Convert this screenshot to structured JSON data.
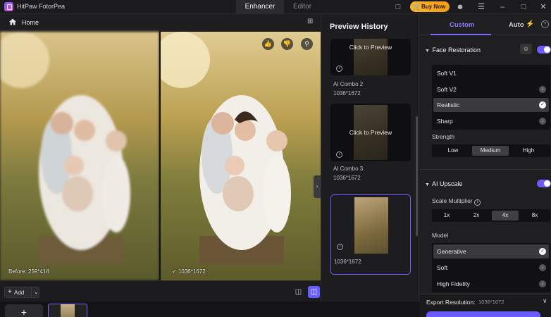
{
  "app": {
    "name": "HitPaw FotorPea"
  },
  "mode_tabs": [
    {
      "label": "Enhancer",
      "active": true
    },
    {
      "label": "Editor",
      "active": false
    }
  ],
  "title_icons": [
    "chat-icon",
    "gift-icon",
    "user-icon",
    "menu-icon",
    "minimize-icon",
    "maximize-icon",
    "close-icon"
  ],
  "buy_button": {
    "label": "Buy Now"
  },
  "home": {
    "label": "Home"
  },
  "canvas": {
    "before_label": "Before: 259*418",
    "after_label": "1036*1672"
  },
  "bottom": {
    "add_label": "Add",
    "zoom_level": 0
  },
  "history": {
    "title": "Preview History",
    "items": [
      {
        "cta": "Click to Preview",
        "name": "AI Combo 2",
        "size": "1036*1672"
      },
      {
        "cta": "Click to Preview",
        "name": "AI Combo 3",
        "size": "1036*1672"
      },
      {
        "cta": "",
        "name": "",
        "size": "1036*1672",
        "selected": true
      }
    ]
  },
  "panel": {
    "tabs": [
      {
        "label": "Custom",
        "active": true
      },
      {
        "label": "Auto",
        "active": false
      }
    ],
    "face_restoration": {
      "title": "Face Restoration",
      "enabled": true,
      "options": [
        {
          "label": "Soft V1",
          "mark": ""
        },
        {
          "label": "Soft V2",
          "mark": "download"
        },
        {
          "label": "Realistic",
          "mark": "check",
          "active": true
        },
        {
          "label": "Sharp",
          "mark": "download"
        }
      ],
      "strength_label": "Strength",
      "strength_options": [
        "Low",
        "Medium",
        "High"
      ],
      "strength_selected": "Medium"
    },
    "ai_upscale": {
      "title": "AI Upscale",
      "enabled": true,
      "scale_label": "Scale Multiplier",
      "scale_options": [
        "1x",
        "2x",
        "4x",
        "8x"
      ],
      "scale_selected": "4x",
      "model_label": "Model",
      "models": [
        {
          "label": "Generative",
          "mark": "check",
          "active": true
        },
        {
          "label": "Soft",
          "mark": "download"
        },
        {
          "label": "High Fidelity",
          "mark": "download"
        }
      ]
    },
    "export": {
      "label": "Export Resolution:",
      "value": "1036*1672"
    }
  },
  "colors": {
    "accent": "#6b5cff",
    "buy_gradient": "#f39c12"
  }
}
